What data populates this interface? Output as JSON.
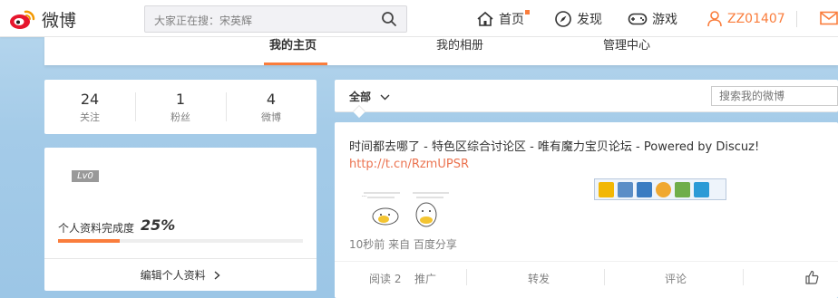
{
  "header": {
    "logo_text": "微博",
    "search_placeholder": "大家正在搜：宋英辉",
    "nav": {
      "home": "首页",
      "discover": "发现",
      "games": "游戏",
      "user": "ZZ01407"
    }
  },
  "tabs": [
    "我的主页",
    "我的相册",
    "管理中心"
  ],
  "stats": [
    {
      "num": "24",
      "label": "关注"
    },
    {
      "num": "1",
      "label": "粉丝"
    },
    {
      "num": "4",
      "label": "微博"
    }
  ],
  "profile": {
    "level": "Lv0",
    "completion_label": "个人资料完成度",
    "completion_value": "25%",
    "completion_fraction": 0.25,
    "edit_label": "编辑个人资料"
  },
  "feed": {
    "filter_label": "全部",
    "search_placeholder": "搜索我的微博"
  },
  "post": {
    "text": "时间都去哪了 - 特色区综合讨论区 - 唯有魔力宝贝论坛 - Powered by Discuz!",
    "link": "http://t.cn/RzmUPSR",
    "meta": "10秒前 来自 百度分享",
    "actions": {
      "read": "阅读 2",
      "promote": "推广",
      "repost": "转发",
      "comment": "评论"
    }
  },
  "colors": {
    "accent": "#fa7d3c",
    "link": "#eb7350",
    "background": "#a4cbe8"
  }
}
